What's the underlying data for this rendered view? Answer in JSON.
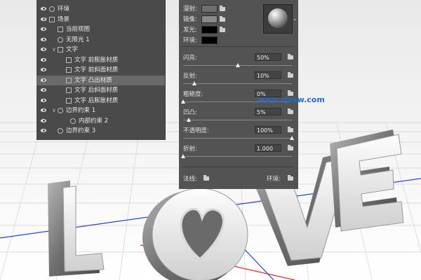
{
  "scene_panel": {
    "items": [
      {
        "label": "环境",
        "icon": "environment-icon"
      },
      {
        "label": "场景",
        "icon": "scene-icon"
      },
      {
        "label": "当前视图",
        "icon": "view-icon"
      },
      {
        "label": "无限光 1",
        "icon": "light-icon"
      },
      {
        "label": "文字",
        "icon": "text-3d-icon"
      },
      {
        "label": "文字 前膨胀材质",
        "icon": "material-icon"
      },
      {
        "label": "文字 前斜面材质",
        "icon": "material-icon"
      },
      {
        "label": "文字 凸出材质",
        "icon": "material-icon",
        "selected": true
      },
      {
        "label": "文字 后斜面材质",
        "icon": "material-icon"
      },
      {
        "label": "文字 后膨胀材质",
        "icon": "material-icon"
      },
      {
        "label": "边界约束 1",
        "icon": "constraint-icon"
      },
      {
        "label": "内部约束 2",
        "icon": "constraint-icon"
      },
      {
        "label": "边界约束 3",
        "icon": "constraint-icon"
      }
    ]
  },
  "properties_panel": {
    "color_rows": [
      {
        "label": "漫射:",
        "color": "#6e6e6e"
      },
      {
        "label": "镜像:",
        "color": "#8a8a8a"
      },
      {
        "label": "发光:",
        "color": "#000000"
      },
      {
        "label": "环境:",
        "color": "#000000"
      }
    ],
    "sliders": [
      {
        "label": "闪亮:",
        "value": "50%",
        "fraction": 0.5
      },
      {
        "label": "反射:",
        "value": "10%",
        "fraction": 0.1
      },
      {
        "label": "粗糙度:",
        "value": "0%",
        "fraction": 0.0
      },
      {
        "label": "凹凸:",
        "value": "5%",
        "fraction": 0.05
      },
      {
        "label": "不透明度:",
        "value": "100%",
        "fraction": 1.0
      },
      {
        "label": "折射:",
        "value": "1.000",
        "fraction": 0.0
      }
    ],
    "bottom": {
      "normal_label": "法线:",
      "env_label": "环境:"
    }
  },
  "watermark": "www.rjzxw.com",
  "scene_text": "LOVE"
}
